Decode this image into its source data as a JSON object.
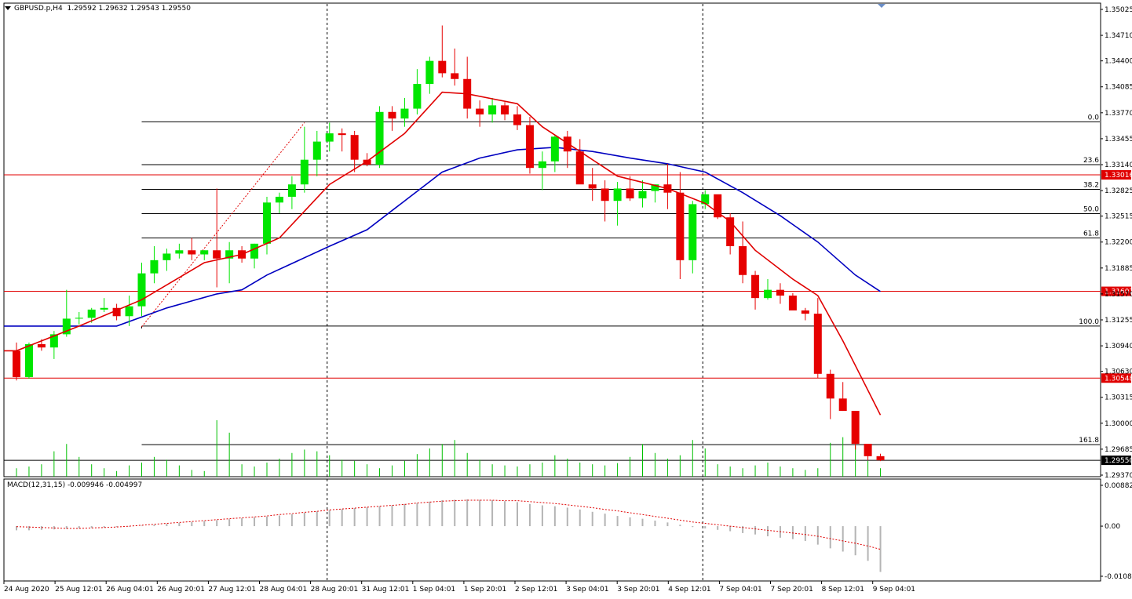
{
  "header": {
    "symbol": "GBPUSD.p,H4",
    "ohlc": "1.29592 1.29632 1.29543 1.29550"
  },
  "macd": {
    "label": "MACD(12,31,15) -0.009946 -0.004997",
    "ticks": [
      "0.008829",
      "0.00",
      "-0.01084"
    ],
    "range": [
      -0.01084,
      0.008829
    ]
  },
  "colors": {
    "bull": "#00e600",
    "bear": "#e60000",
    "ma_fast": "#e00000",
    "ma_slow": "#0000c0",
    "fib": "#000000",
    "hline": "#e00000",
    "volume": "#00c000",
    "macd_hist": "#b4b4b4",
    "macd_signal": "#e00000"
  },
  "chart_data": {
    "type": "candlestick",
    "symbol": "GBPUSD.p",
    "timeframe": "H4",
    "ylim": [
      1.2937,
      1.35025
    ],
    "y_ticks": [
      "1.35025",
      "1.34710",
      "1.34400",
      "1.34085",
      "1.33770",
      "1.33455",
      "1.33140",
      "1.32825",
      "1.32515",
      "1.32200",
      "1.31885",
      "1.31570",
      "1.31255",
      "1.30940",
      "1.30630",
      "1.30315",
      "1.30000",
      "1.29685",
      "1.29370"
    ],
    "x_labels": [
      "24 Aug 2020",
      "25 Aug 12:01",
      "26 Aug 04:01",
      "26 Aug 20:01",
      "27 Aug 12:01",
      "28 Aug 04:01",
      "28 Aug 20:01",
      "31 Aug 12:01",
      "1 Sep 04:01",
      "1 Sep 20:01",
      "2 Sep 12:01",
      "3 Sep 04:01",
      "3 Sep 20:01",
      "4 Sep 12:01",
      "7 Sep 04:01",
      "7 Sep 20:01",
      "8 Sep 12:01",
      "9 Sep 04:01"
    ],
    "candles": [
      [
        1.3088,
        1.3098,
        1.3052,
        1.3056
      ],
      [
        1.3056,
        1.3098,
        1.3054,
        1.3096
      ],
      [
        1.3096,
        1.3102,
        1.3088,
        1.3092
      ],
      [
        1.3092,
        1.3112,
        1.3078,
        1.3108
      ],
      [
        1.3108,
        1.3162,
        1.3105,
        1.3127
      ],
      [
        1.3127,
        1.3135,
        1.312,
        1.3128
      ],
      [
        1.3128,
        1.314,
        1.3122,
        1.3138
      ],
      [
        1.3138,
        1.3152,
        1.3135,
        1.314
      ],
      [
        1.314,
        1.3145,
        1.3125,
        1.313
      ],
      [
        1.313,
        1.3155,
        1.3118,
        1.3142
      ],
      [
        1.3142,
        1.3195,
        1.313,
        1.3182
      ],
      [
        1.3182,
        1.3215,
        1.317,
        1.3198
      ],
      [
        1.3198,
        1.3212,
        1.3185,
        1.3206
      ],
      [
        1.3206,
        1.3218,
        1.32,
        1.321
      ],
      [
        1.321,
        1.3225,
        1.3198,
        1.3205
      ],
      [
        1.3205,
        1.321,
        1.3198,
        1.321
      ],
      [
        1.321,
        1.3285,
        1.3165,
        1.32
      ],
      [
        1.32,
        1.322,
        1.317,
        1.321
      ],
      [
        1.321,
        1.3215,
        1.3195,
        1.32
      ],
      [
        1.32,
        1.3218,
        1.3188,
        1.3218
      ],
      [
        1.3218,
        1.3275,
        1.3205,
        1.3268
      ],
      [
        1.3268,
        1.328,
        1.3255,
        1.3275
      ],
      [
        1.3275,
        1.33,
        1.326,
        1.329
      ],
      [
        1.329,
        1.336,
        1.328,
        1.332
      ],
      [
        1.332,
        1.3355,
        1.33,
        1.3342
      ],
      [
        1.3342,
        1.3365,
        1.333,
        1.3352
      ],
      [
        1.3352,
        1.3358,
        1.333,
        1.335
      ],
      [
        1.335,
        1.3355,
        1.3305,
        1.332
      ],
      [
        1.332,
        1.3328,
        1.3312,
        1.3314
      ],
      [
        1.3314,
        1.3385,
        1.331,
        1.3378
      ],
      [
        1.3378,
        1.3385,
        1.3355,
        1.337
      ],
      [
        1.337,
        1.3395,
        1.336,
        1.3382
      ],
      [
        1.3382,
        1.343,
        1.3375,
        1.3412
      ],
      [
        1.3412,
        1.3445,
        1.34,
        1.344
      ],
      [
        1.344,
        1.3483,
        1.342,
        1.3425
      ],
      [
        1.3425,
        1.3455,
        1.341,
        1.3418
      ],
      [
        1.3418,
        1.3445,
        1.337,
        1.3382
      ],
      [
        1.3382,
        1.3392,
        1.336,
        1.3375
      ],
      [
        1.3375,
        1.3395,
        1.3365,
        1.3386
      ],
      [
        1.3386,
        1.339,
        1.3368,
        1.3375
      ],
      [
        1.3375,
        1.3385,
        1.3356,
        1.3362
      ],
      [
        1.3362,
        1.3372,
        1.3303,
        1.331
      ],
      [
        1.331,
        1.333,
        1.3283,
        1.3318
      ],
      [
        1.3318,
        1.335,
        1.3305,
        1.3348
      ],
      [
        1.3348,
        1.3355,
        1.331,
        1.333
      ],
      [
        1.333,
        1.3345,
        1.3295,
        1.329
      ],
      [
        1.329,
        1.331,
        1.327,
        1.3285
      ],
      [
        1.3285,
        1.3295,
        1.3245,
        1.327
      ],
      [
        1.327,
        1.3293,
        1.324,
        1.3285
      ],
      [
        1.3285,
        1.33,
        1.327,
        1.3273
      ],
      [
        1.3273,
        1.3295,
        1.3262,
        1.3282
      ],
      [
        1.3282,
        1.329,
        1.3268,
        1.329
      ],
      [
        1.329,
        1.3315,
        1.326,
        1.328
      ],
      [
        1.328,
        1.3305,
        1.3175,
        1.3198
      ],
      [
        1.3198,
        1.327,
        1.3182,
        1.3266
      ],
      [
        1.3266,
        1.3283,
        1.326,
        1.3278
      ],
      [
        1.3278,
        1.326,
        1.3248,
        1.325
      ],
      [
        1.325,
        1.3255,
        1.3205,
        1.3215
      ],
      [
        1.3215,
        1.3245,
        1.317,
        1.318
      ],
      [
        1.318,
        1.3185,
        1.3138,
        1.3152
      ],
      [
        1.3152,
        1.3175,
        1.315,
        1.3162
      ],
      [
        1.3162,
        1.317,
        1.3145,
        1.3155
      ],
      [
        1.3155,
        1.3158,
        1.314,
        1.3137
      ],
      [
        1.3137,
        1.314,
        1.3125,
        1.3133
      ],
      [
        1.3133,
        1.3152,
        1.3055,
        1.306
      ],
      [
        1.306,
        1.3065,
        1.3005,
        1.303
      ],
      [
        1.303,
        1.305,
        1.3015,
        1.3015
      ],
      [
        1.3015,
        1.3015,
        1.2968,
        1.2975
      ],
      [
        1.2975,
        1.2972,
        1.2955,
        1.296
      ],
      [
        1.296,
        1.2963,
        1.2954,
        1.2955
      ]
    ],
    "ma_fast_points": [
      [
        0,
        1.3088
      ],
      [
        5,
        1.3118
      ],
      [
        10,
        1.315
      ],
      [
        15,
        1.3195
      ],
      [
        18,
        1.3205
      ],
      [
        21,
        1.3225
      ],
      [
        25,
        1.329
      ],
      [
        28,
        1.3318
      ],
      [
        31,
        1.3352
      ],
      [
        34,
        1.3402
      ],
      [
        36,
        1.34
      ],
      [
        40,
        1.3388
      ],
      [
        42,
        1.336
      ],
      [
        45,
        1.333
      ],
      [
        48,
        1.33
      ],
      [
        52,
        1.3285
      ],
      [
        55,
        1.3267
      ],
      [
        57,
        1.3245
      ],
      [
        59,
        1.321
      ],
      [
        62,
        1.3175
      ],
      [
        64,
        1.3155
      ],
      [
        66,
        1.31
      ],
      [
        68,
        1.304
      ],
      [
        69,
        1.301
      ]
    ],
    "ma_slow_points": [
      [
        0,
        1.3118
      ],
      [
        8,
        1.3118
      ],
      [
        12,
        1.314
      ],
      [
        16,
        1.3157
      ],
      [
        18,
        1.3162
      ],
      [
        20,
        1.318
      ],
      [
        25,
        1.3215
      ],
      [
        28,
        1.3235
      ],
      [
        31,
        1.327
      ],
      [
        34,
        1.3305
      ],
      [
        37,
        1.3322
      ],
      [
        40,
        1.3332
      ],
      [
        43,
        1.3335
      ],
      [
        46,
        1.333
      ],
      [
        49,
        1.3322
      ],
      [
        52,
        1.3315
      ],
      [
        55,
        1.3305
      ],
      [
        58,
        1.328
      ],
      [
        61,
        1.3252
      ],
      [
        64,
        1.322
      ],
      [
        67,
        1.318
      ],
      [
        69,
        1.316
      ]
    ],
    "volume": [
      0.15,
      0.18,
      0.22,
      0.45,
      0.58,
      0.35,
      0.22,
      0.15,
      0.1,
      0.2,
      0.25,
      0.35,
      0.3,
      0.2,
      0.12,
      0.1,
      1.0,
      0.78,
      0.22,
      0.18,
      0.25,
      0.32,
      0.42,
      0.48,
      0.45,
      0.38,
      0.3,
      0.28,
      0.22,
      0.15,
      0.2,
      0.28,
      0.4,
      0.5,
      0.58,
      0.65,
      0.42,
      0.3,
      0.22,
      0.2,
      0.18,
      0.22,
      0.25,
      0.38,
      0.32,
      0.25,
      0.22,
      0.2,
      0.24,
      0.35,
      0.58,
      0.42,
      0.32,
      0.38,
      0.65,
      0.5,
      0.22,
      0.18,
      0.15,
      0.2,
      0.25,
      0.18,
      0.15,
      0.12,
      0.15,
      0.6,
      0.7,
      0.55,
      0.28,
      0.15
    ],
    "macd_hist": [
      -0.0009,
      -0.0009,
      -0.0008,
      -0.0007,
      -0.0006,
      -0.0005,
      -0.0004,
      -0.0003,
      -0.0002,
      -0.0001,
      0.0001,
      0.0003,
      0.0005,
      0.0007,
      0.0009,
      0.0011,
      0.0013,
      0.0015,
      0.0017,
      0.0019,
      0.0021,
      0.0023,
      0.0026,
      0.0029,
      0.0032,
      0.0035,
      0.0037,
      0.0039,
      0.0041,
      0.0043,
      0.0045,
      0.0048,
      0.005,
      0.0053,
      0.0056,
      0.0057,
      0.0058,
      0.0057,
      0.0056,
      0.0054,
      0.0052,
      0.0048,
      0.0045,
      0.0043,
      0.004,
      0.0036,
      0.0031,
      0.0027,
      0.0022,
      0.0019,
      0.0016,
      0.0012,
      0.0008,
      0.0003,
      -0.0002,
      -0.0005,
      -0.0008,
      -0.0011,
      -0.0015,
      -0.0018,
      -0.0022,
      -0.0025,
      -0.0028,
      -0.0032,
      -0.004,
      -0.0048,
      -0.0055,
      -0.0063,
      -0.0075,
      -0.0099
    ],
    "macd_signal": [
      -0.0001,
      -0.0002,
      -0.0003,
      -0.0004,
      -0.0005,
      -0.0005,
      -0.0004,
      -0.0003,
      -0.0002,
      0.0,
      0.0002,
      0.0004,
      0.0006,
      0.0008,
      0.001,
      0.0012,
      0.0014,
      0.0016,
      0.0018,
      0.002,
      0.0022,
      0.0025,
      0.0027,
      0.003,
      0.0032,
      0.0035,
      0.0037,
      0.0039,
      0.0041,
      0.0043,
      0.0045,
      0.0047,
      0.005,
      0.0052,
      0.0054,
      0.0055,
      0.0056,
      0.0056,
      0.0056,
      0.0055,
      0.0055,
      0.0053,
      0.0051,
      0.0049,
      0.0046,
      0.0043,
      0.004,
      0.0036,
      0.0033,
      0.0029,
      0.0025,
      0.0021,
      0.0017,
      0.0013,
      0.0009,
      0.0006,
      0.0003,
      0.0,
      -0.0003,
      -0.0006,
      -0.0009,
      -0.0012,
      -0.0015,
      -0.0018,
      -0.0022,
      -0.0027,
      -0.0032,
      -0.0037,
      -0.0043,
      -0.005
    ],
    "fib_levels": [
      {
        "label": "0.0",
        "price": 1.3366
      },
      {
        "label": "23.6",
        "price": 1.3314
      },
      {
        "label": "38.2",
        "price": 1.3284
      },
      {
        "label": "50.0",
        "price": 1.32545
      },
      {
        "label": "61.8",
        "price": 1.3225
      },
      {
        "label": "100.0",
        "price": 1.3118
      },
      {
        "label": "161.8",
        "price": 1.2974
      }
    ],
    "fib_start_index": 10,
    "trendline": {
      "from": [
        10,
        1.3117
      ],
      "to": [
        23,
        1.3365
      ]
    },
    "price_lines": [
      {
        "label": "1.33016",
        "price": 1.33016,
        "color": "#e00000"
      },
      {
        "label": "1.31602",
        "price": 1.31602,
        "color": "#e00000"
      },
      {
        "label": "1.30548",
        "price": 1.30548,
        "color": "#e00000"
      },
      {
        "label": "1.29550",
        "price": 1.2955,
        "color": "#000000"
      }
    ],
    "period_separators": [
      25,
      55
    ]
  }
}
